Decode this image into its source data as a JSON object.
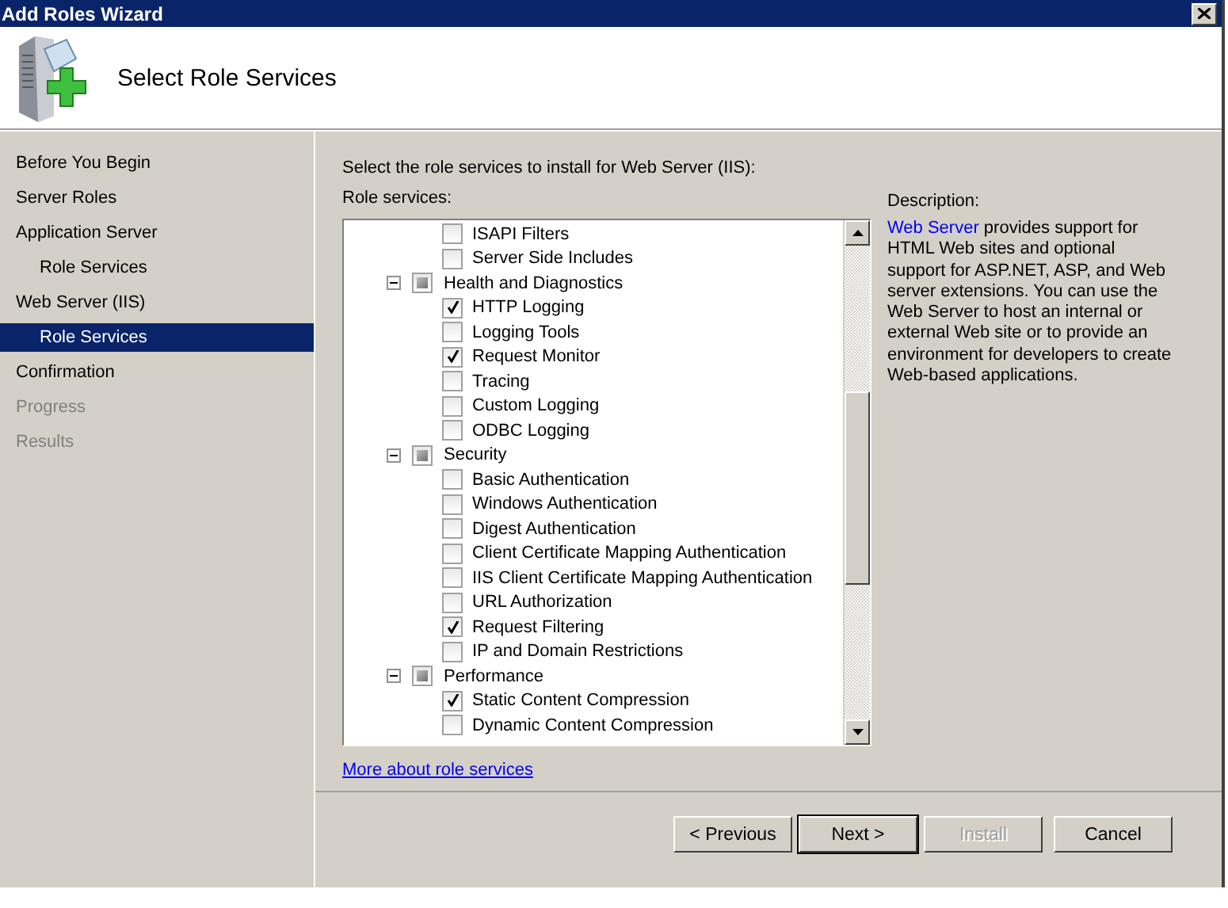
{
  "window": {
    "title": "Add Roles Wizard"
  },
  "header": {
    "title": "Select Role Services"
  },
  "nav": [
    {
      "label": "Before You Begin",
      "kind": "step",
      "selected": false,
      "disabled": false
    },
    {
      "label": "Server Roles",
      "kind": "step",
      "selected": false,
      "disabled": false
    },
    {
      "label": "Application Server",
      "kind": "step",
      "selected": false,
      "disabled": false
    },
    {
      "label": "Role Services",
      "kind": "substep",
      "selected": false,
      "disabled": false
    },
    {
      "label": "Web Server (IIS)",
      "kind": "step",
      "selected": false,
      "disabled": false
    },
    {
      "label": "Role Services",
      "kind": "substep",
      "selected": true,
      "disabled": false
    },
    {
      "label": "Confirmation",
      "kind": "step",
      "selected": false,
      "disabled": false
    },
    {
      "label": "Progress",
      "kind": "step",
      "selected": false,
      "disabled": true
    },
    {
      "label": "Results",
      "kind": "step",
      "selected": false,
      "disabled": true
    }
  ],
  "instruction": "Select the role services to install for Web Server (IIS):",
  "role_services_label": "Role services:",
  "role_services": [
    {
      "kind": "leaf",
      "label": "ISAPI Filters",
      "checked": false
    },
    {
      "kind": "leaf",
      "label": "Server Side Includes",
      "checked": false
    },
    {
      "kind": "group",
      "label": "Health and Diagnostics",
      "expanded": true,
      "partial": true,
      "children": [
        {
          "kind": "leaf",
          "label": "HTTP Logging",
          "checked": true
        },
        {
          "kind": "leaf",
          "label": "Logging Tools",
          "checked": false
        },
        {
          "kind": "leaf",
          "label": "Request Monitor",
          "checked": true
        },
        {
          "kind": "leaf",
          "label": "Tracing",
          "checked": false
        },
        {
          "kind": "leaf",
          "label": "Custom Logging",
          "checked": false
        },
        {
          "kind": "leaf",
          "label": "ODBC Logging",
          "checked": false
        }
      ]
    },
    {
      "kind": "group",
      "label": "Security",
      "expanded": true,
      "partial": true,
      "children": [
        {
          "kind": "leaf",
          "label": "Basic Authentication",
          "checked": false
        },
        {
          "kind": "leaf",
          "label": "Windows Authentication",
          "checked": false
        },
        {
          "kind": "leaf",
          "label": "Digest Authentication",
          "checked": false
        },
        {
          "kind": "leaf",
          "label": "Client Certificate Mapping Authentication",
          "checked": false
        },
        {
          "kind": "leaf",
          "label": "IIS Client Certificate Mapping Authentication",
          "checked": false
        },
        {
          "kind": "leaf",
          "label": "URL Authorization",
          "checked": false
        },
        {
          "kind": "leaf",
          "label": "Request Filtering",
          "checked": true
        },
        {
          "kind": "leaf",
          "label": "IP and Domain Restrictions",
          "checked": false
        }
      ]
    },
    {
      "kind": "group",
      "label": "Performance",
      "expanded": true,
      "partial": true,
      "children": [
        {
          "kind": "leaf",
          "label": "Static Content Compression",
          "checked": true
        },
        {
          "kind": "leaf",
          "label": "Dynamic Content Compression",
          "checked": false
        }
      ]
    }
  ],
  "more_link": "More about role services",
  "description": {
    "label": "Description:",
    "link": "Web Server",
    "text": " provides support for HTML Web sites and optional support for ASP.NET, ASP, and Web server extensions. You can use the Web Server to host an internal or external Web site or to provide an environment for developers to create Web-based applications."
  },
  "buttons": [
    {
      "label": "< Previous",
      "default": false,
      "disabled": false
    },
    {
      "label": "Next >",
      "default": true,
      "disabled": false
    },
    {
      "label": "Install",
      "default": false,
      "disabled": true
    },
    {
      "label": "Cancel",
      "default": false,
      "disabled": false
    }
  ]
}
